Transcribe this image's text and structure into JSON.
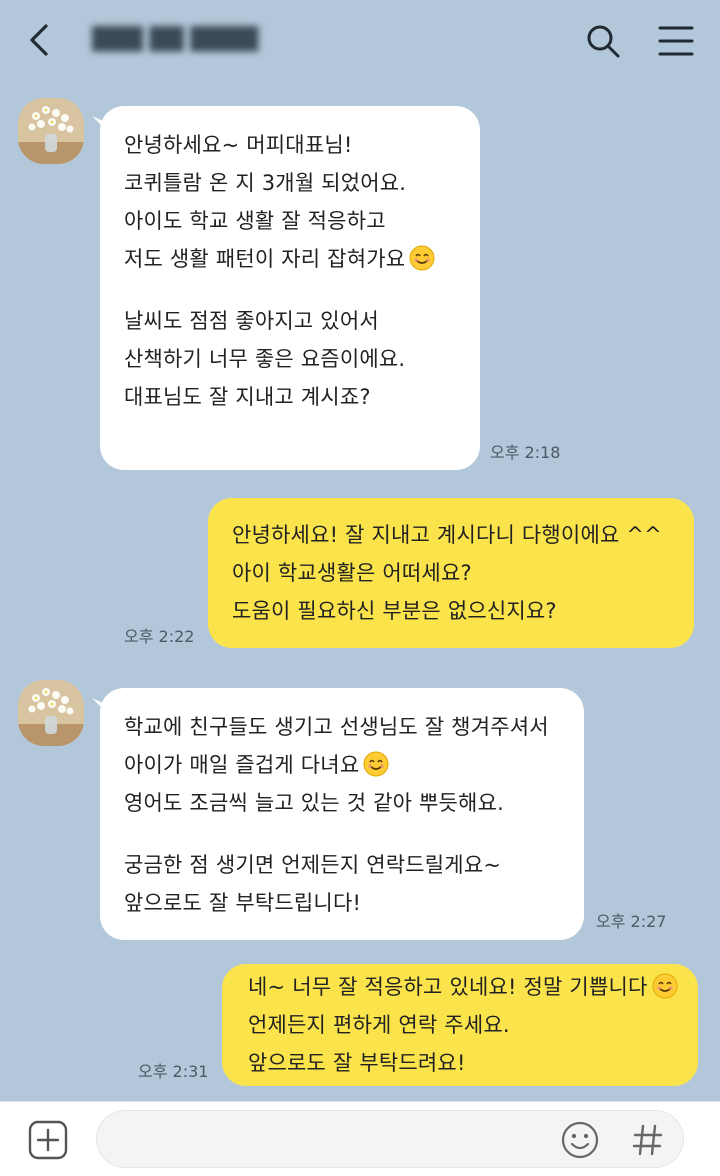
{
  "header": {
    "title": "███ ██ ████",
    "icons": {
      "back": "back-arrow-icon",
      "search": "search-icon",
      "menu": "hamburger-menu-icon"
    }
  },
  "messages": [
    {
      "direction": "received",
      "lines": [
        "안녕하세요~ 머피대표님!",
        "코퀴틀람 온 지 3개월 되었어요.",
        "아이도 학교 생활 잘 적응하고",
        "저도 생활 패턴이 자리 잡혀가요"
      ],
      "lines2": [
        "날씨도 점점 좋아지고 있어서",
        "산책하기 너무 좋은 요즘이에요.",
        "대표님도 잘 지내고 계시죠?"
      ],
      "time": "오후 2:18"
    },
    {
      "direction": "sent",
      "lines": [
        "안녕하세요! 잘 지내고 계시다니 다행이에요 ^^",
        "아이 학교생활은 어떠세요?",
        "도움이 필요하신 부분은 없으신지요?"
      ],
      "time": "오후 2:22"
    },
    {
      "direction": "received",
      "lines": [
        "학교에 친구들도 생기고 선생님도 잘 챙겨주셔서",
        "아이가 매일 즐겁게 다녀요",
        "영어도 조금씩 늘고 있는 것 같아 뿌듯해요."
      ],
      "lines2": [
        "궁금한 점 생기면 언제든지 연락드릴게요~",
        "앞으로도 잘 부탁드립니다!"
      ],
      "time": "오후 2:27"
    },
    {
      "direction": "sent",
      "lines": [
        "네~ 너무 잘 적응하고 있네요! 정말 기쁩니다",
        "언제든지 편하게 연락 주세요.",
        "앞으로도 잘 부탁드려요!"
      ],
      "time": "오후 2:31"
    }
  ],
  "input_bar": {
    "placeholder": "",
    "icons": {
      "add": "plus-square-icon",
      "emoticon": "smiley-icon",
      "hash": "hash-icon"
    }
  },
  "colors": {
    "background": "#b2c7d9",
    "received_bubble": "#ffffff",
    "sent_bubble": "#fbe44b"
  }
}
